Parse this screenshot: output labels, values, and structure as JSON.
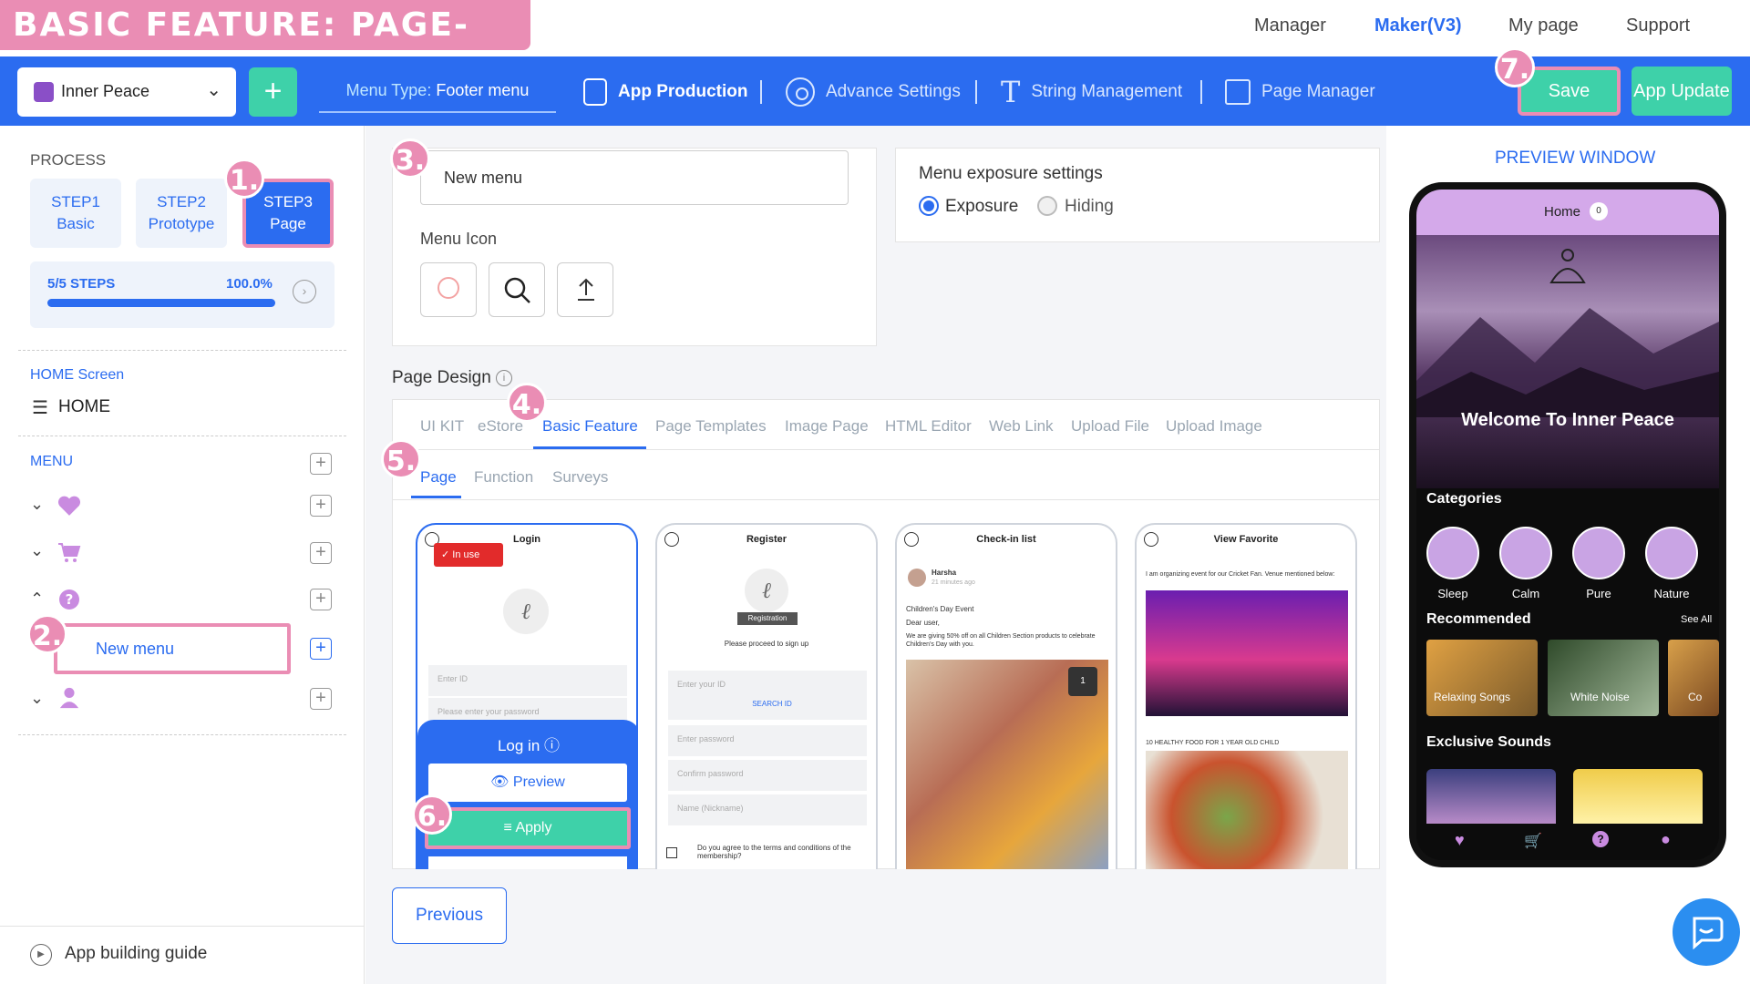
{
  "banner": "BASIC FEATURE: PAGE- LOGIN",
  "topnav": {
    "manager": "Manager",
    "maker": "Maker(V3)",
    "mypage": "My page",
    "support": "Support"
  },
  "toolbar": {
    "app_name": "Inner Peace",
    "menu_type_label": "Menu Type:",
    "menu_type_value": "Footer menu",
    "app_production": "App Production",
    "advance_settings": "Advance Settings",
    "string_management": "String Management",
    "page_manager": "Page Manager",
    "save": "Save",
    "app_update": "App Update"
  },
  "markers": [
    "1.",
    "2.",
    "3.",
    "4.",
    "5.",
    "6.",
    "7."
  ],
  "sidebar": {
    "process": "PROCESS",
    "steps": [
      {
        "line1": "STEP1",
        "line2": "Basic"
      },
      {
        "line1": "STEP2",
        "line2": "Prototype"
      },
      {
        "line1": "STEP3",
        "line2": "Page"
      }
    ],
    "progress_label": "5/5 STEPS",
    "progress_percent": "100.0%",
    "progress_fraction": 1.0,
    "home_screen_label": "HOME Screen",
    "home_item": "HOME",
    "menu_label": "MENU",
    "new_menu_item": "New menu",
    "guide": "App building guide"
  },
  "main": {
    "menu_name_value": "New menu",
    "menu_icon_label": "Menu Icon",
    "exposure_title": "Menu exposure settings",
    "exposure_option": "Exposure",
    "hiding_option": "Hiding",
    "page_design_label": "Page Design",
    "design_tabs": [
      "UI KIT",
      "eStore",
      "Basic Feature",
      "Page Templates",
      "Image Page",
      "HTML Editor",
      "Web Link",
      "Upload File",
      "Upload Image"
    ],
    "sub_tabs": [
      "Page",
      "Function",
      "Surveys"
    ],
    "previous": "Previous"
  },
  "templates": {
    "login": {
      "title": "Login",
      "in_use": "In use",
      "enter_id": "Enter ID",
      "password": "Please enter your password",
      "login_button": "Log in",
      "preview": "Preview",
      "apply": "Apply"
    },
    "register": {
      "title": "Register",
      "registration": "Registration",
      "proceed": "Please proceed to sign up",
      "enter_id": "Enter your ID",
      "search_id": "SEARCH ID",
      "enter_password": "Enter password",
      "confirm_password": "Confirm password",
      "name": "Name (Nickname)",
      "agree": "Do you agree to the terms and conditions of the membership?"
    },
    "checkin": {
      "title": "Check-in list",
      "user": "Harsha",
      "time": "21 minutes ago",
      "event": "Children's Day Event",
      "dear": "Dear user,",
      "body": "We are giving 50% off on all Children Section products to celebrate Children's Day with you.",
      "badge": "1"
    },
    "favorite": {
      "title": "View Favorite",
      "desc": "I am organizing event for our Cricket Fan. Venue mentioned below:",
      "food": "10 HEALTHY FOOD FOR 1 YEAR OLD CHILD"
    }
  },
  "preview": {
    "label": "PREVIEW WINDOW",
    "home": "Home",
    "home_badge": "0",
    "welcome": "Welcome To Inner Peace",
    "categories_label": "Categories",
    "categories": [
      "Sleep",
      "Calm",
      "Pure",
      "Nature"
    ],
    "recommended": "Recommended",
    "see_all": "See All",
    "rec_items": [
      "Relaxing Songs",
      "White Noise",
      "Co"
    ],
    "exclusive": "Exclusive Sounds"
  },
  "colors": {
    "primary": "#2b6cf0",
    "accent": "#3ed1a9",
    "highlight": "#ea8db4",
    "menu_icon": "#c98be0"
  }
}
